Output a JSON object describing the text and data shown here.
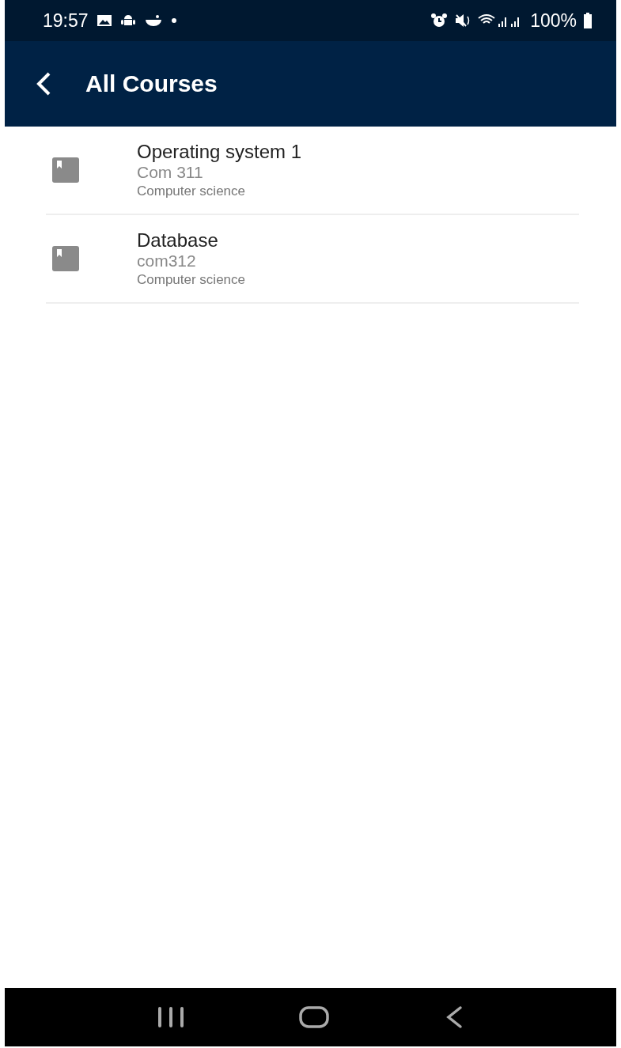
{
  "status_bar": {
    "time": "19:57",
    "battery": "100%"
  },
  "app_bar": {
    "title": "All Courses"
  },
  "courses": [
    {
      "name": "Operating system 1",
      "code": "Com 311",
      "department": "Computer science"
    },
    {
      "name": "Database",
      "code": "com312",
      "department": "Computer science"
    }
  ]
}
